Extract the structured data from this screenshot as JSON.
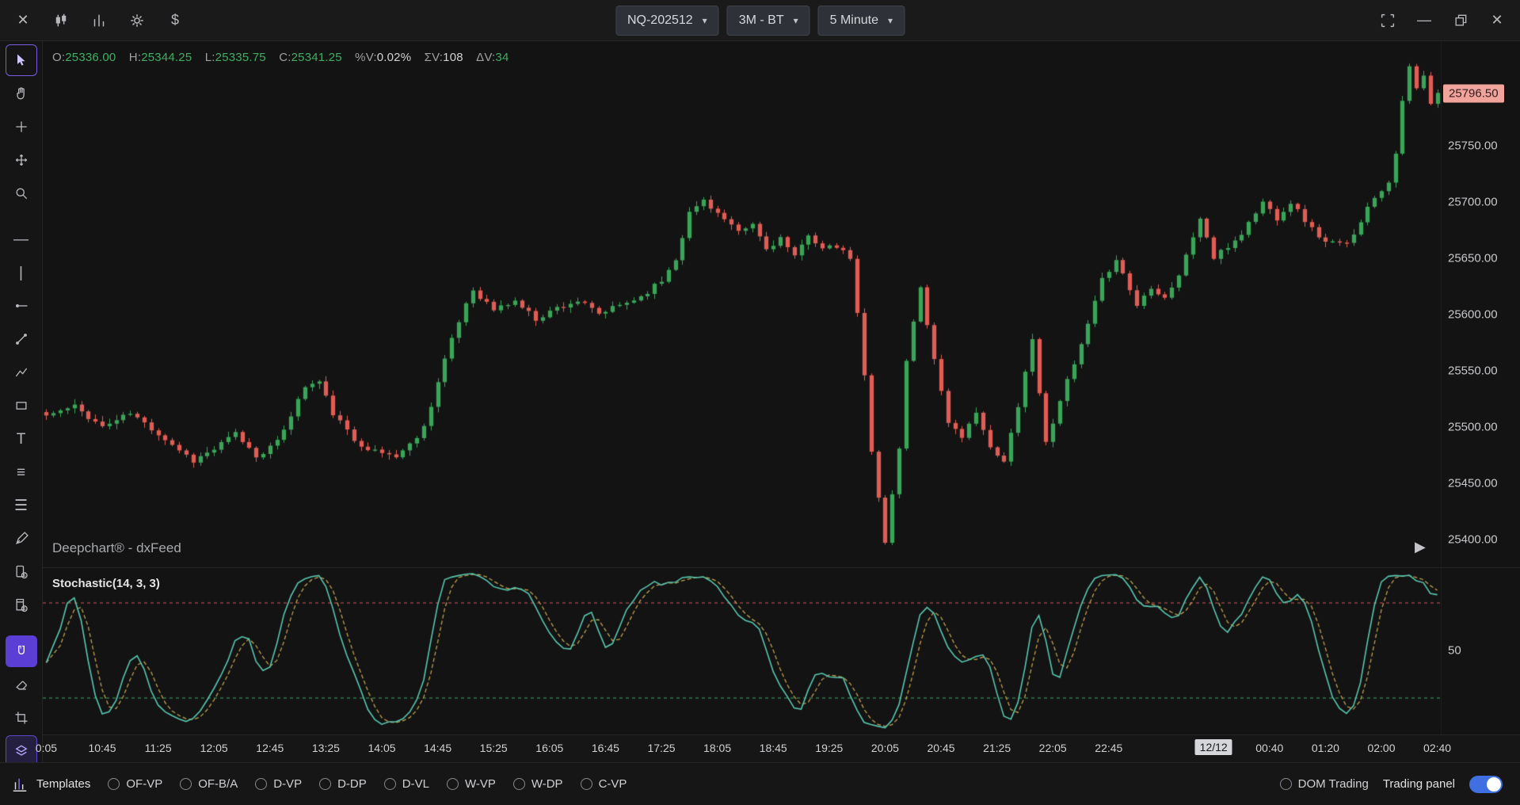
{
  "topbar": {
    "symbol_dropdown": "NQ-202512",
    "range_dropdown": "3M - BT",
    "interval_dropdown": "5 Minute"
  },
  "icons": {
    "close": "✕",
    "minimize": "—",
    "dollar": "$",
    "text_tool": "T",
    "horizontal_line": "—",
    "vertical_line": "|",
    "parallel_lines": "≡",
    "list_lines": "☰",
    "chevron": "▾",
    "play": "▶"
  },
  "ohlc": {
    "o_label": "O:",
    "o": "25336.00",
    "h_label": "H:",
    "h": "25344.25",
    "l_label": "L:",
    "l": "25335.75",
    "c_label": "C:",
    "c": "25341.25",
    "pv_label": "%V:",
    "pv": "0.02%",
    "sv_label": "ΣV:",
    "sv": "108",
    "dv_label": "ΔV:",
    "dv": "34"
  },
  "watermark": "Deepchart® - dxFeed",
  "price_axis": {
    "ticks": [
      "25750.00",
      "25700.00",
      "25650.00",
      "25600.00",
      "25550.00",
      "25500.00",
      "25450.00",
      "25400.00"
    ],
    "tick_values": [
      25750,
      25700,
      25650,
      25600,
      25550,
      25500,
      25450,
      25400
    ],
    "last_price_label": "25796.50",
    "last_price_value": 25796.5
  },
  "stochastic": {
    "label": "Stochastic(14, 3, 3)",
    "axis_label": "50",
    "upper_level": 80,
    "lower_level": 20
  },
  "time_axis": {
    "labels": [
      {
        "i": 0,
        "t": "0:05"
      },
      {
        "i": 8,
        "t": "10:45"
      },
      {
        "i": 16,
        "t": "11:25"
      },
      {
        "i": 24,
        "t": "12:05"
      },
      {
        "i": 32,
        "t": "12:45"
      },
      {
        "i": 40,
        "t": "13:25"
      },
      {
        "i": 48,
        "t": "14:05"
      },
      {
        "i": 56,
        "t": "14:45"
      },
      {
        "i": 64,
        "t": "15:25"
      },
      {
        "i": 72,
        "t": "16:05"
      },
      {
        "i": 80,
        "t": "16:45"
      },
      {
        "i": 88,
        "t": "17:25"
      },
      {
        "i": 96,
        "t": "18:05"
      },
      {
        "i": 104,
        "t": "18:45"
      },
      {
        "i": 112,
        "t": "19:25"
      },
      {
        "i": 120,
        "t": "20:05"
      },
      {
        "i": 128,
        "t": "20:45"
      },
      {
        "i": 136,
        "t": "21:25"
      },
      {
        "i": 144,
        "t": "22:05"
      },
      {
        "i": 152,
        "t": "22:45"
      },
      {
        "i": 167,
        "t": "12/12",
        "hl": true
      },
      {
        "i": 175,
        "t": "00:40"
      },
      {
        "i": 183,
        "t": "01:20"
      },
      {
        "i": 191,
        "t": "02:00"
      },
      {
        "i": 199,
        "t": "02:40"
      }
    ]
  },
  "bottombar": {
    "templates_label": "Templates",
    "options": [
      "OF-VP",
      "OF-B/A",
      "D-VP",
      "D-DP",
      "D-VL",
      "W-VP",
      "W-DP",
      "C-VP"
    ],
    "dom_trading_label": "DOM Trading",
    "trading_panel_label": "Trading panel",
    "toggle_on": true
  },
  "colors": {
    "up": "#3aa558",
    "down": "#df5d55",
    "accent_purple": "#5b3fd4",
    "last_price_bg": "#f0a49c",
    "stoch_k": "#58c7b0",
    "stoch_d": "#c0a050",
    "level_high": "#d65c5c",
    "level_low": "#3fae62"
  },
  "chart_data": {
    "type": "candlestick",
    "symbol": "NQ-202512",
    "interval": "5 Minute",
    "candle_count": 200,
    "price_range_top": 25843,
    "price_range_bottom": 25375,
    "indicator": {
      "type": "stochastic",
      "params": [
        14,
        3,
        3
      ],
      "levels": [
        80,
        20
      ]
    },
    "price_anchors": [
      [
        0,
        25510
      ],
      [
        4,
        25518
      ],
      [
        8,
        25500
      ],
      [
        12,
        25512
      ],
      [
        16,
        25494
      ],
      [
        21,
        25470
      ],
      [
        24,
        25480
      ],
      [
        27,
        25494
      ],
      [
        30,
        25474
      ],
      [
        33,
        25486
      ],
      [
        37,
        25536
      ],
      [
        39,
        25540
      ],
      [
        41,
        25512
      ],
      [
        44,
        25488
      ],
      [
        47,
        25478
      ],
      [
        50,
        25474
      ],
      [
        52,
        25484
      ],
      [
        54,
        25500
      ],
      [
        57,
        25560
      ],
      [
        60,
        25610
      ],
      [
        61,
        25622
      ],
      [
        64,
        25604
      ],
      [
        67,
        25612
      ],
      [
        70,
        25596
      ],
      [
        73,
        25606
      ],
      [
        76,
        25612
      ],
      [
        79,
        25600
      ],
      [
        82,
        25608
      ],
      [
        85,
        25616
      ],
      [
        88,
        25630
      ],
      [
        90,
        25650
      ],
      [
        92,
        25690
      ],
      [
        94,
        25702
      ],
      [
        96,
        25690
      ],
      [
        99,
        25672
      ],
      [
        101,
        25680
      ],
      [
        103,
        25658
      ],
      [
        105,
        25668
      ],
      [
        107,
        25650
      ],
      [
        109,
        25672
      ],
      [
        111,
        25658
      ],
      [
        113,
        25660
      ],
      [
        115,
        25650
      ],
      [
        116,
        25600
      ],
      [
        117,
        25545
      ],
      [
        118,
        25480
      ],
      [
        120,
        25396
      ],
      [
        121,
        25440
      ],
      [
        122,
        25480
      ],
      [
        123,
        25560
      ],
      [
        125,
        25625
      ],
      [
        127,
        25560
      ],
      [
        129,
        25505
      ],
      [
        131,
        25488
      ],
      [
        133,
        25515
      ],
      [
        135,
        25480
      ],
      [
        137,
        25468
      ],
      [
        139,
        25520
      ],
      [
        141,
        25578
      ],
      [
        143,
        25485
      ],
      [
        145,
        25525
      ],
      [
        147,
        25555
      ],
      [
        149,
        25590
      ],
      [
        151,
        25630
      ],
      [
        153,
        25650
      ],
      [
        156,
        25608
      ],
      [
        158,
        25625
      ],
      [
        160,
        25615
      ],
      [
        162,
        25635
      ],
      [
        165,
        25686
      ],
      [
        167,
        25650
      ],
      [
        169,
        25660
      ],
      [
        171,
        25672
      ],
      [
        174,
        25700
      ],
      [
        176,
        25686
      ],
      [
        178,
        25700
      ],
      [
        181,
        25676
      ],
      [
        183,
        25664
      ],
      [
        186,
        25662
      ],
      [
        188,
        25684
      ],
      [
        190,
        25705
      ],
      [
        192,
        25718
      ],
      [
        193,
        25745
      ],
      [
        194,
        25788
      ],
      [
        195,
        25820
      ],
      [
        196,
        25800
      ],
      [
        197,
        25812
      ],
      [
        198,
        25786
      ],
      [
        199,
        25796
      ]
    ]
  }
}
